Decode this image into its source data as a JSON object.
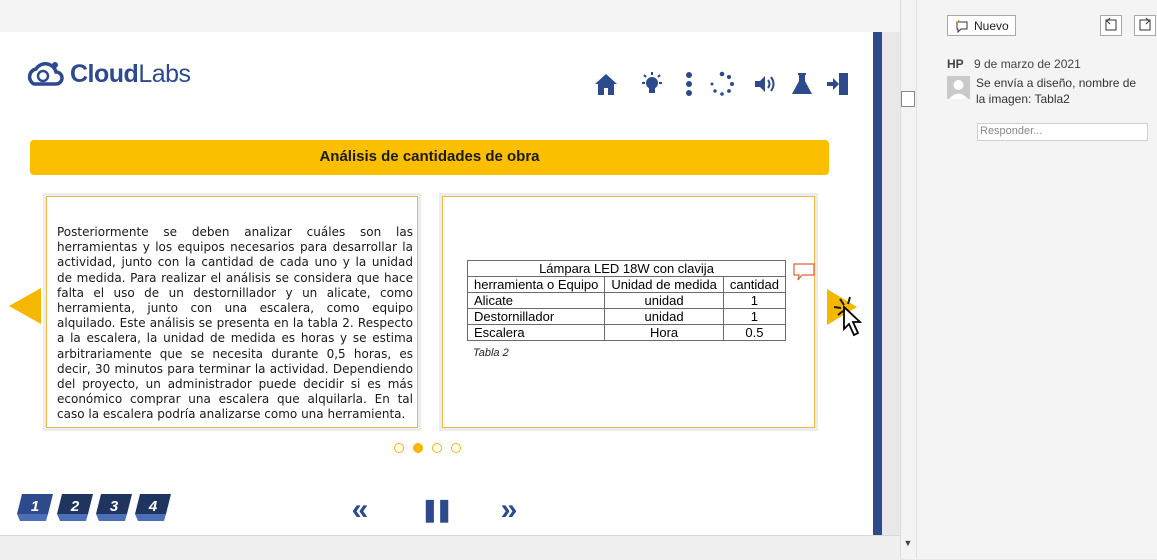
{
  "app": {
    "logo_text_bold": "Cloud",
    "logo_text_light": "Labs",
    "toolbar_icons": [
      "home-icon",
      "lightbulb-icon",
      "more-vertical-icon",
      "loading-icon",
      "volume-icon",
      "flask-icon",
      "exit-icon"
    ]
  },
  "slide": {
    "title": "Análisis de cantidades de obra",
    "paragraph": "Posteriormente se deben analizar cuáles son las herramientas y los equipos necesarios para desarrollar la actividad, junto con la cantidad de cada uno y la unidad de medida. Para realizar el análisis se considera que hace falta el uso de un destornillador y un alicate, como herramienta, junto con una escalera, como equipo alquilado. Este análisis se presenta en la tabla 2. Respecto a la escalera, la unidad de medida es horas y se estima arbitrariamente que se necesita durante 0,5 horas, es decir, 30 minutos para terminar la actividad. Dependiendo del proyecto, un administrador puede decidir si es más económico comprar una escalera que alquilarla. En tal caso la escalera podría analizarse como una herramienta.",
    "table": {
      "title": "Lámpara LED 18W con clavija",
      "headers": [
        "herramienta o Equipo",
        "Unidad de medida",
        "cantidad"
      ],
      "rows": [
        [
          "Alicate",
          "unidad",
          "1"
        ],
        [
          "Destornillador",
          "unidad",
          "1"
        ],
        [
          "Escalera",
          "Hora",
          "0.5"
        ]
      ],
      "caption": "Tabla 2"
    },
    "carousel": {
      "count": 4,
      "active_index": 1
    }
  },
  "footer": {
    "pages": [
      "1",
      "2",
      "3",
      "4"
    ],
    "controls": {
      "prev": "«",
      "pause": "❚❚",
      "next": "»"
    }
  },
  "comments": {
    "new_label": "Nuevo",
    "author": "HP",
    "date": "9 de marzo de 2021",
    "text": "Se envía a diseño, nombre de la imagen: Tabla2",
    "reply_placeholder": "Responder..."
  },
  "colors": {
    "brand_blue": "#2c4a8c",
    "accent_yellow": "#fbbf00"
  }
}
